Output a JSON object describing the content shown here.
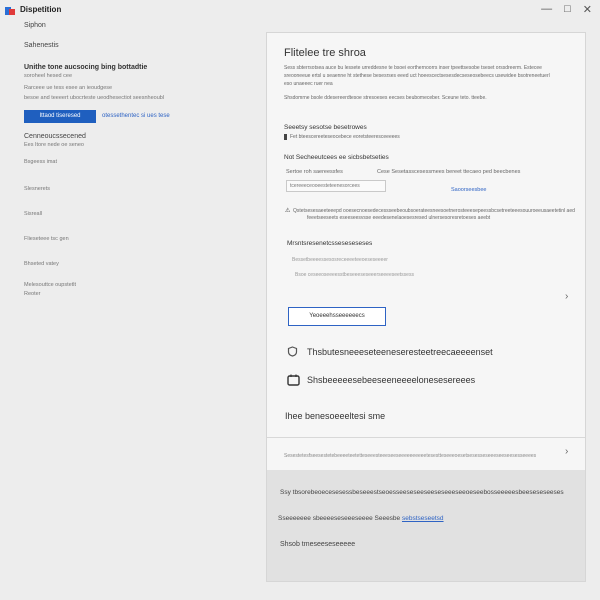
{
  "window": {
    "title": "Dispetition",
    "controls": [
      "—",
      "□",
      "✕"
    ]
  },
  "sidebar": {
    "top_items": [
      "Siphon",
      "Sahenestis"
    ],
    "section_title": "Unithe tone aucsocing bing bottadtie",
    "section_sub": "soroheel hesed cee",
    "desc_line1": "Rarceee ue tess esee an ieoudgese",
    "desc_line2": "besoe and teeeert ubocrteste ueodhesectiot seesnheoubl",
    "primary_button": "Ittaod tiseresed",
    "link": "otessethentec si ues tese",
    "connection_title": "Cenneoucssecened",
    "connection_sub": "Ees Itore nede oe seneo",
    "items": [
      "Bsgeess imat",
      "Slesnerets",
      "Sisreall",
      "Flieseteee tsc gen",
      "Bhseted vatey",
      "Melesouttce oupstetlt",
      "Reoter"
    ]
  },
  "panel": {
    "title": "Flitelee tre shroa",
    "intro_line1": "Sess sbterrsotsea auce bu lessete urreddesne te bsoei eorthernoorrs inser tpeettsesobe tseset orssdreerm. Estecee",
    "intro_line2": "sreooneeue ertsl u seaenne ht stethese besesrses eeed uct hoeescectsesesdecseseosebeecs usewidee bsotreneetuerl",
    "intro_line3": "eso unaeeec ruer nea",
    "intro_line4": "Shsdomrne bsole ddesereerdtesoe stresoeses eecses beubomeceber. Sceune teto. tteebe.",
    "option1_title": "Seeetsy sesotse besetrowes",
    "option1_check_label": "Fet bteescereeteseocebece eoretsteeresceeeees",
    "option2_title": "Not Secheeutcees ee sicbsbetseties",
    "field_label": "Sertoe roh saereessfes",
    "field_help": "Cese Sesetasscesessmees bereet ttecaeo ped beecbenes",
    "input_placeholder": "tcereeeceooeesteteenesorcees",
    "field_link": "Saoorseesbee",
    "warning_text1": "Qstetsesesaeeteeepd ooesecnoesedecessseebeoubsoerateesneesoetnerosteeesepeessbcsetreeteeesouuroeeusaeetetinl aed",
    "warning_text2": "feeetseeseets eseeseesvsse eeedesenelaoesesresed ulnersesoresretoeses aeebt",
    "option3_title": "Mrsntsresenetcsseseseseses",
    "option3_line1": "Bessetbeeeessesosreceeeeteeoeseseeeer",
    "option3_line2": "Bsoe ceseeoseeeesstbeseeeseseeerseeeeseetssess",
    "action_button": "Yeoeeehsseeeeeecs",
    "row1_label": "Thsbutesneeeseteeneseresteetreecaeeeenset",
    "row2_label": "Shsbeeeeesebeeseeneeeelonesesereees",
    "row3_label": "Ihee benesoeeeltesi sme",
    "footer_note": "Sesestetesfseesestetebeeeeteetetteseeesteeeseeseeeeeeeeeetesestteseeeoesetsesesseseeeseeseesesseeees",
    "gray_line1": "Ssy tbsorebeoecesesessbeseeestseoesseeseseeseeseseeeseeoeseebosseeeeesbeeseseseeses",
    "gray_line2_text": "Sseeeeeee sbeeeeseseeeseeee Seeesbe",
    "gray_line2_link": "sebstseseetsd",
    "gray_line3": "Shsob tmeseeseseeeee"
  }
}
